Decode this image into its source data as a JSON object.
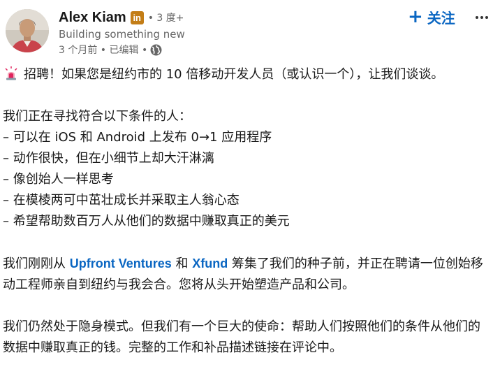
{
  "author": {
    "name": "Alex Kiam",
    "badge": "in",
    "degree": "• 3 度+",
    "headline": "Building something new",
    "posted": "3 个月前 • 已编辑 •"
  },
  "actions": {
    "follow_plus": "+",
    "follow_label": "关注"
  },
  "icons": {
    "avatar": "avatar",
    "badge": "linkedin-premium-icon",
    "visibility": "globe-icon",
    "more": "more-icon",
    "siren": "siren-icon"
  },
  "post": {
    "intro": "招聘！如果您是纽约市的 10 倍移动开发人员（或认识一个），让我们谈谈。",
    "criteria_heading": "我们正在寻找符合以下条件的人：",
    "criteria": [
      "– 可以在 iOS 和 Android 上发布 0→1 应用程序",
      "– 动作很快，但在小细节上却大汗淋漓",
      "– 像创始人一样思考",
      "– 在模棱两可中茁壮成长并采取主人翁心态",
      "– 希望帮助数百万人从他们的数据中赚取真正的美元"
    ],
    "funding": {
      "prefix": "我们刚刚从 ",
      "mention_1": "Upfront Ventures",
      "middle": " 和 ",
      "mention_2": "Xfund",
      "suffix": " 筹集了我们的种子前，并正在聘请一位创始移动工程师亲自到纽约与我会合。您将从头开始塑造产品和公司。"
    },
    "closing": "我们仍然处于隐身模式。但我们有一个巨大的使命：帮助人们按照他们的条件从他们的数据中赚取真正的钱。完整的工作和补品描述链接在评论中。"
  },
  "colors": {
    "link": "#0a66c2",
    "badge": "#c37d16",
    "secondary_text": "#666666"
  }
}
